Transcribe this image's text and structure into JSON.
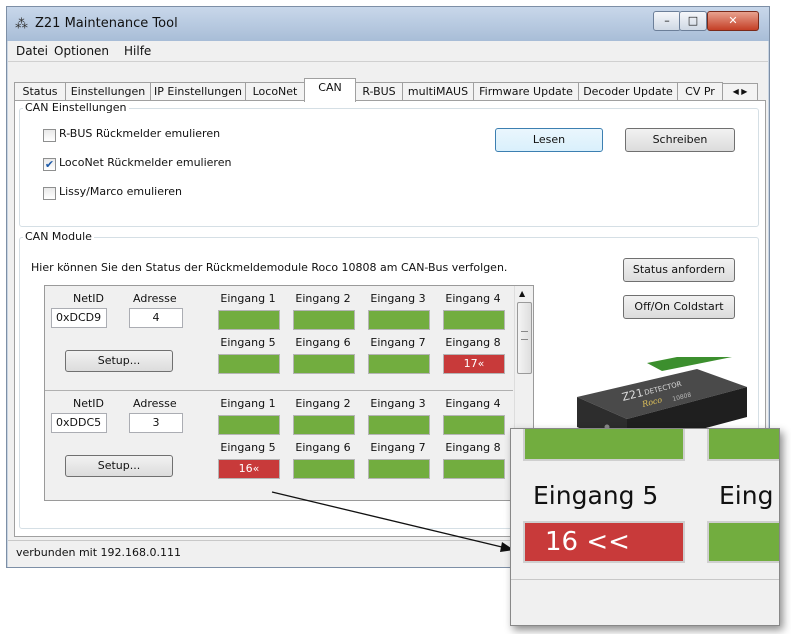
{
  "window": {
    "title": "Z21 Maintenance Tool",
    "app_icon": "z21-logo-icon"
  },
  "menu": [
    {
      "label": "Datei"
    },
    {
      "label": "Optionen"
    },
    {
      "label": "Hilfe"
    }
  ],
  "tabs": [
    {
      "label": "Status"
    },
    {
      "label": "Einstellungen"
    },
    {
      "label": "IP Einstellungen"
    },
    {
      "label": "LocoNet"
    },
    {
      "label": "CAN"
    },
    {
      "label": "R-BUS"
    },
    {
      "label": "multiMAUS"
    },
    {
      "label": "Firmware Update"
    },
    {
      "label": "Decoder Update"
    },
    {
      "label": "CV Pr"
    }
  ],
  "can_settings": {
    "group_label": "CAN Einstellungen",
    "checks": [
      {
        "label": "R-BUS Rückmelder emulieren",
        "checked": false
      },
      {
        "label": "LocoNet Rückmelder emulieren",
        "checked": true
      },
      {
        "label": "Lissy/Marco emulieren",
        "checked": false
      }
    ],
    "read_label": "Lesen",
    "write_label": "Schreiben"
  },
  "can_modules": {
    "group_label": "CAN Module",
    "description": "Hier können Sie den Status der Rückmeldemodule Roco 10808 am CAN-Bus verfolgen.",
    "status_label": "Status anfordern",
    "offon_label": "Off/On Coldstart",
    "netid_header": "NetID",
    "address_header": "Adresse",
    "setup_label": "Setup...",
    "input_labels_top": [
      "Eingang 1",
      "Eingang 2",
      "Eingang 3",
      "Eingang 4"
    ],
    "input_labels_bottom": [
      "Eingang 5",
      "Eingang 6",
      "Eingang 7",
      "Eingang 8"
    ],
    "modules": [
      {
        "netid": "0xDCD9",
        "address": "4",
        "inputs_top": [
          "",
          "",
          "",
          ""
        ],
        "inputs_bottom": [
          "",
          "",
          "",
          "17«"
        ]
      },
      {
        "netid": "0xDDC5",
        "address": "3",
        "inputs_top": [
          "",
          "",
          "",
          ""
        ],
        "inputs_bottom": [
          "16«",
          "",
          "",
          ""
        ]
      }
    ]
  },
  "device": {
    "brand": "Z21",
    "name": "DETECTOR",
    "maker": "Roco",
    "model": "10808"
  },
  "status_text": "verbunden mit 192.168.0.111",
  "zoom": {
    "label_a": "Eingang 5",
    "label_b": "Eing",
    "value": "16 <<"
  },
  "colors": {
    "occupied": "#c83a3a",
    "free": "#72ad3f"
  }
}
